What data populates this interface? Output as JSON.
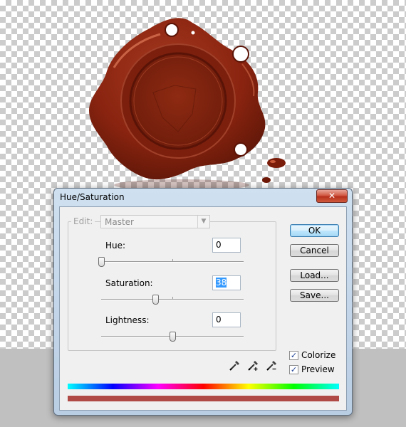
{
  "dialog": {
    "title": "Hue/Saturation",
    "close_glyph": "✕",
    "edit": {
      "label": "Edit:",
      "selected": "Master",
      "arrow": "▼"
    },
    "hue": {
      "label": "Hue:",
      "value": "0",
      "range": [
        -180,
        180
      ]
    },
    "saturation": {
      "label": "Saturation:",
      "value": "38",
      "range": [
        -100,
        100
      ]
    },
    "lightness": {
      "label": "Lightness:",
      "value": "0",
      "range": [
        -100,
        100
      ]
    },
    "buttons": {
      "ok": "OK",
      "cancel": "Cancel",
      "load": "Load...",
      "save": "Save..."
    },
    "colorize": {
      "label": "Colorize",
      "checked": true
    },
    "preview": {
      "label": "Preview",
      "checked": true
    },
    "checkmark": "✓",
    "eyedroppers": [
      "eyedropper-icon",
      "eyedropper-plus-icon",
      "eyedropper-minus-icon"
    ],
    "colors": {
      "input_spectrum": [
        "#00ffff",
        "#0000ff",
        "#ff00ff",
        "#ff0000",
        "#ffff00",
        "#00ff00",
        "#00ffff"
      ],
      "output_color": "#b04a46"
    }
  },
  "canvas": {
    "seal_color": "#8a1f10",
    "pasteboard_color": "#c0c0c0"
  }
}
